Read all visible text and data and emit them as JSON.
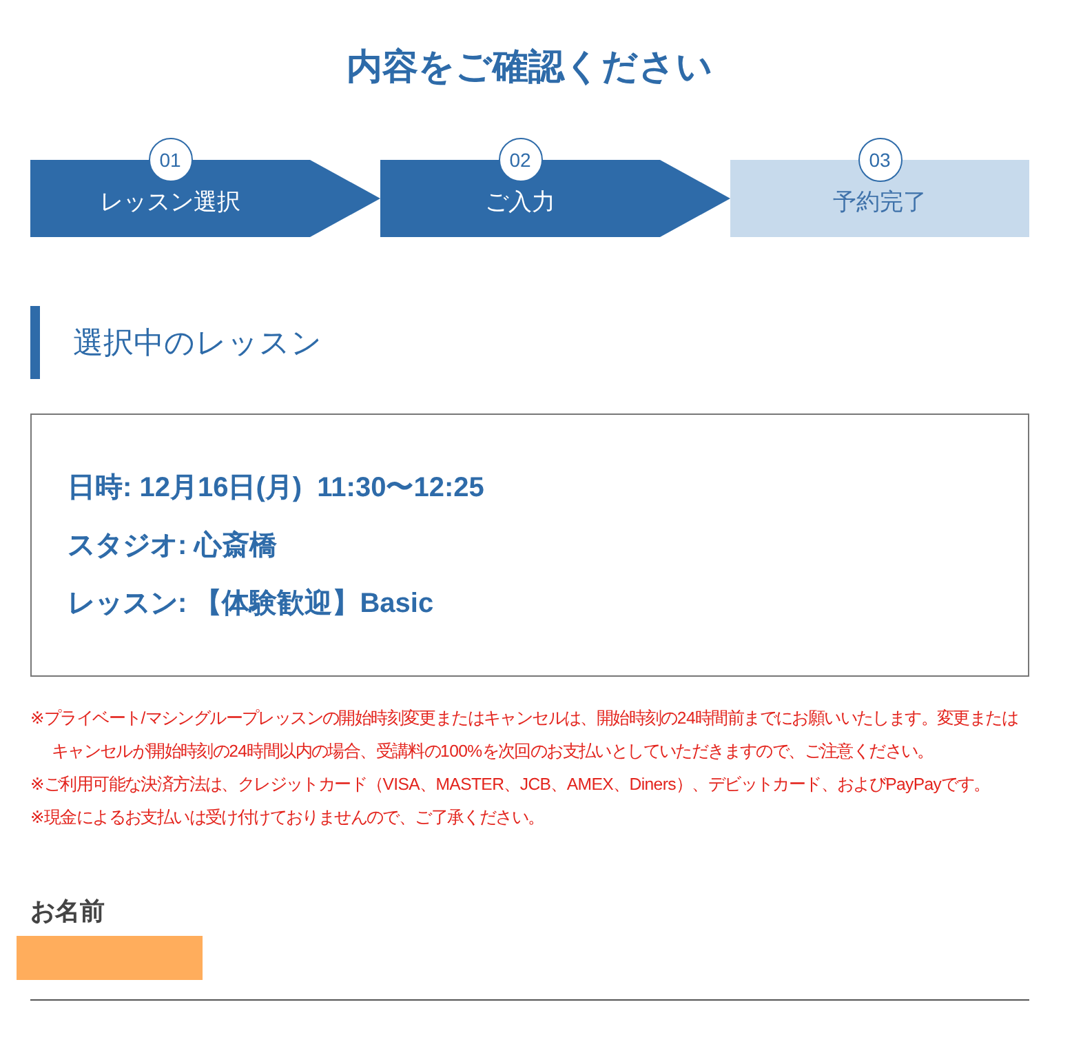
{
  "page_title": "内容をご確認ください",
  "steps": [
    {
      "number": "01",
      "label": "レッスン選択",
      "active": true
    },
    {
      "number": "02",
      "label": "ご入力",
      "active": true
    },
    {
      "number": "03",
      "label": "予約完了",
      "active": false
    }
  ],
  "section": {
    "heading": "選択中のレッスン",
    "lines": [
      "日時: 12月16日(月)  11:30〜12:25",
      "スタジオ: 心斎橋",
      "レッスン: 【体験歓迎】Basic"
    ]
  },
  "notes": [
    "※プライベート/マシングループレッスンの開始時刻変更またはキャンセルは、開始時刻の24時間前までにお願いいたします。変更またはキャンセルが開始時刻の24時間以内の場合、受講料の100%を次回のお支払いとしていただきますので、ご注意ください。",
    "※ご利用可能な決済方法は、クレジットカード（VISA、MASTER、JCB、AMEX、Diners）、デビットカード、およびPayPayです。",
    "※現金によるお支払いは受け付けておりませんので、ご了承ください。"
  ],
  "name_field": {
    "label": "お名前"
  }
}
